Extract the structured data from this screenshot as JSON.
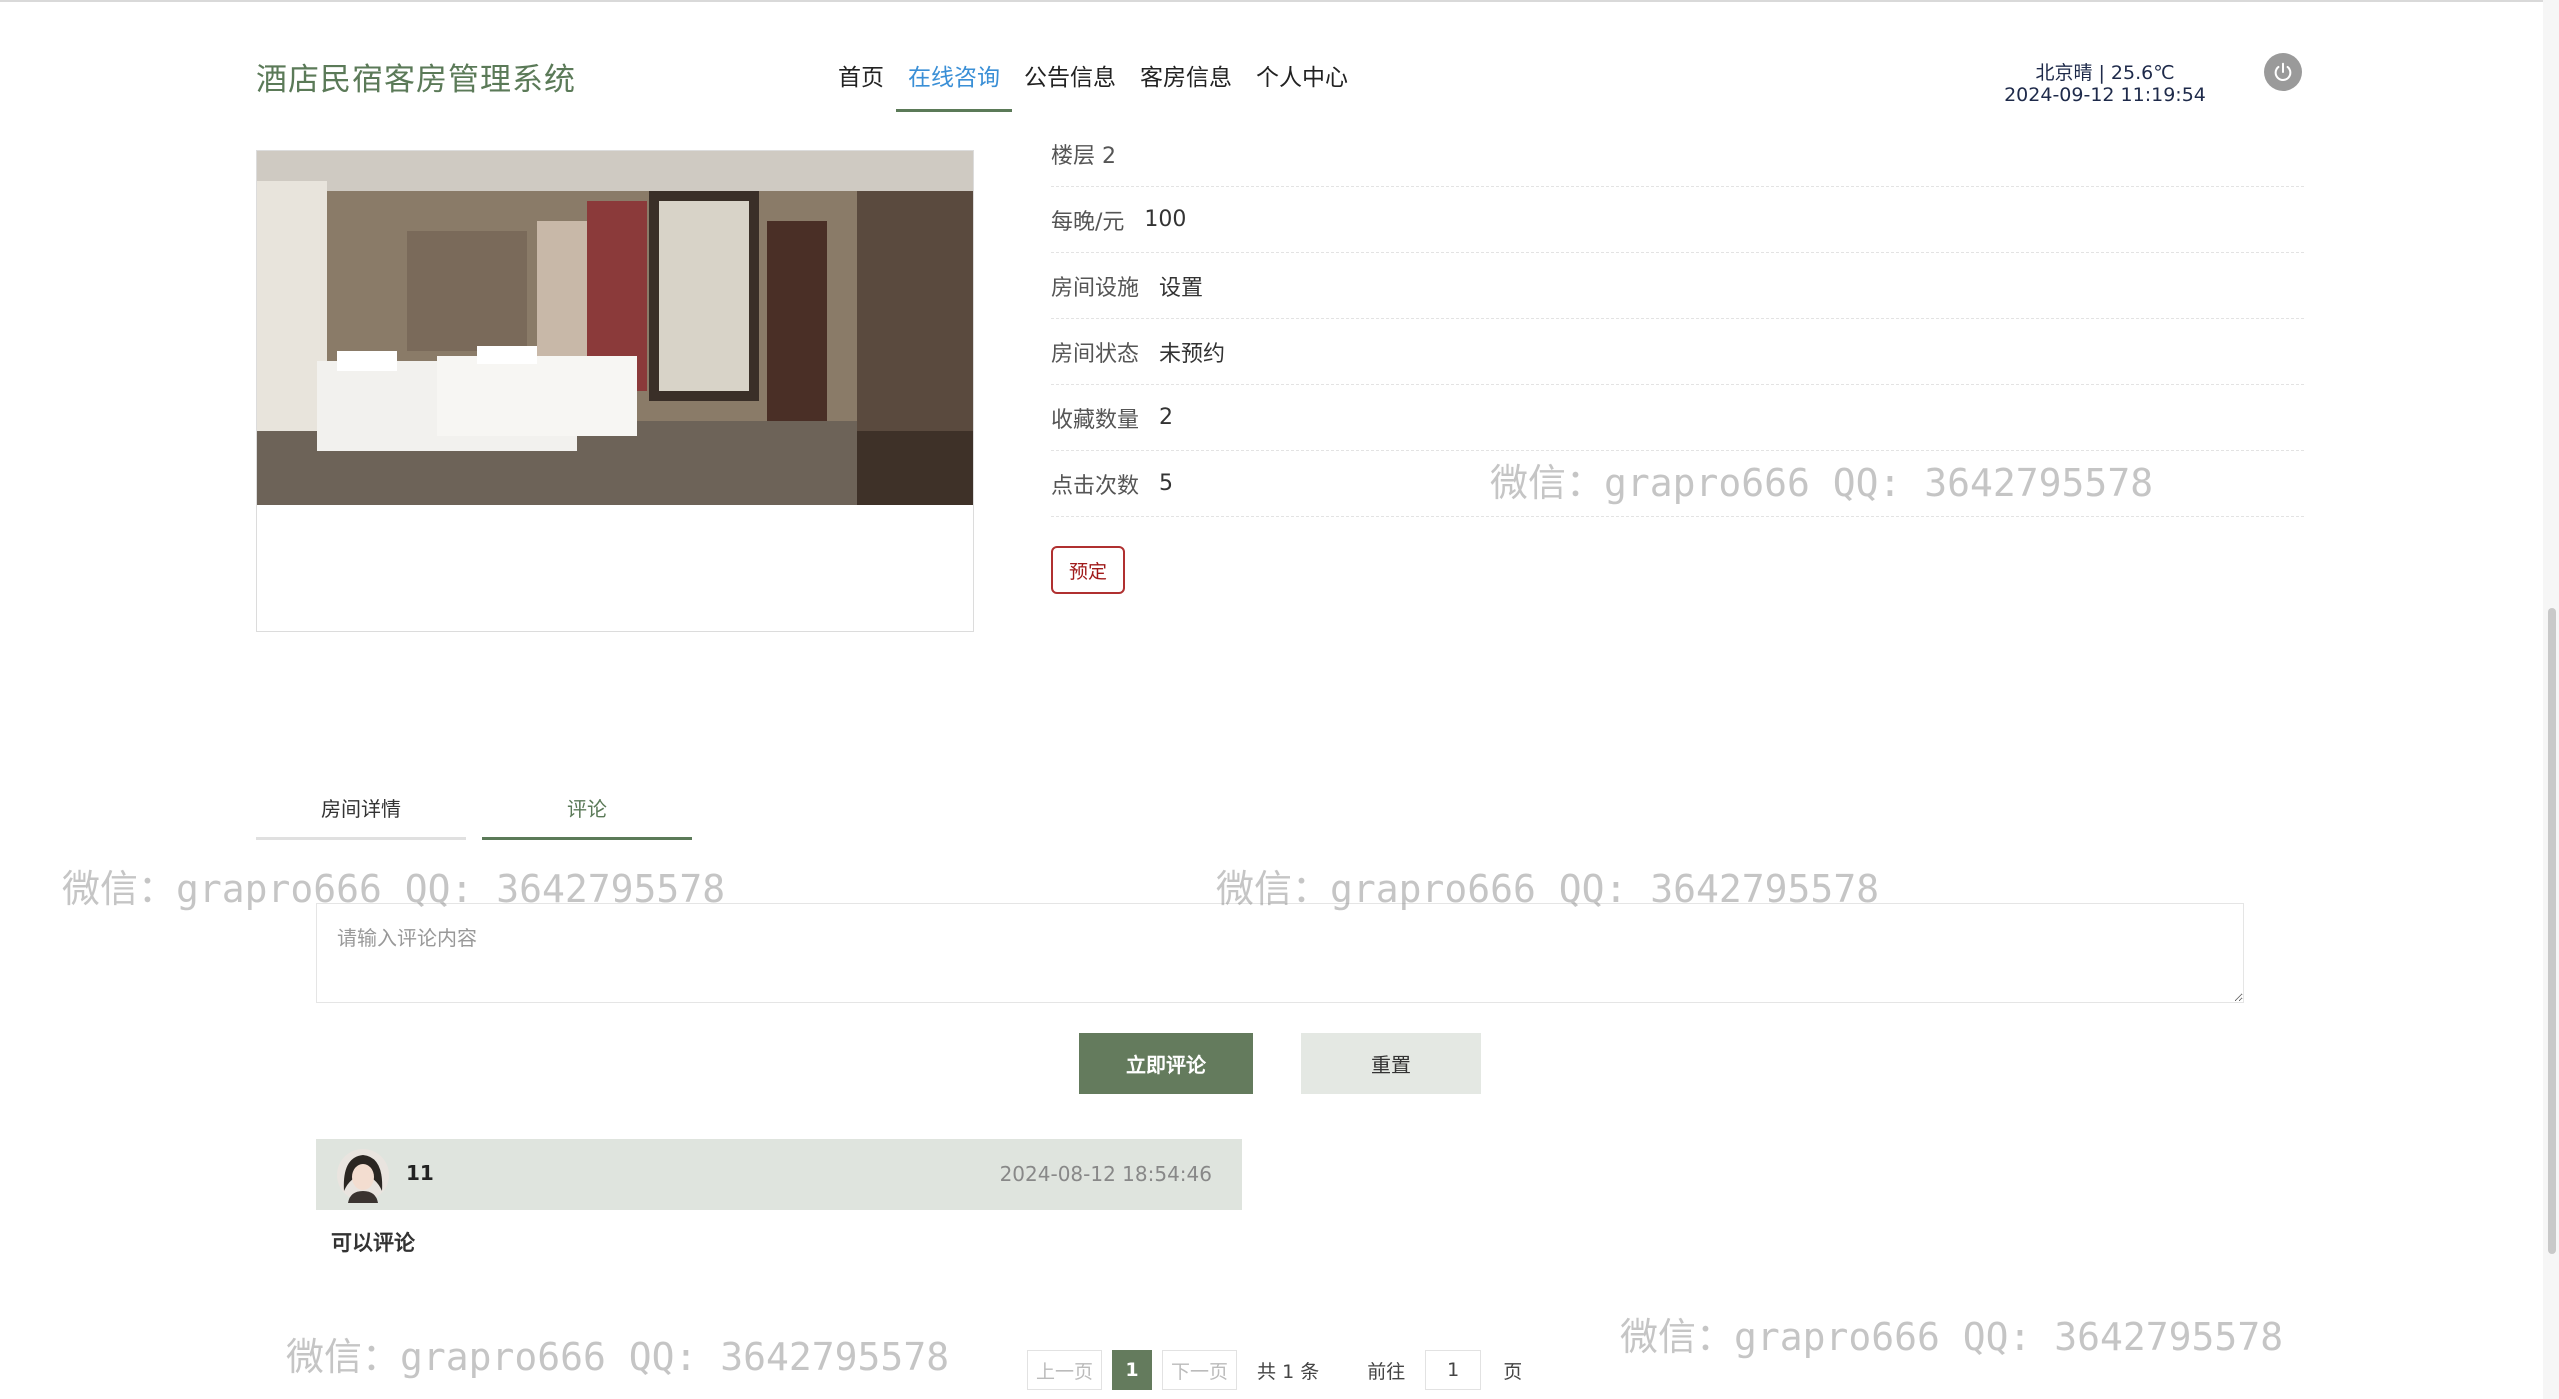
{
  "header": {
    "brand": "酒店民宿客房管理系统",
    "nav": [
      "首页",
      "在线咨询",
      "公告信息",
      "客房信息",
      "个人中心"
    ],
    "active_nav": 1,
    "weather_line1": "北京晴 | 25.6℃",
    "weather_line2": "2024-09-12   11:19:54"
  },
  "details": {
    "partial_row": "楼层  2",
    "rows": [
      {
        "label": "每晚/元",
        "value": "100"
      },
      {
        "label": "房间设施",
        "value": "设置"
      },
      {
        "label": "房间状态",
        "value": "未预约"
      },
      {
        "label": "收藏数量",
        "value": "2"
      },
      {
        "label": "点击次数",
        "value": "5"
      }
    ],
    "book_label": "预定"
  },
  "tabs": [
    "房间详情",
    "评论"
  ],
  "active_tab": 1,
  "comment_form": {
    "placeholder": "请输入评论内容",
    "submit_label": "立即评论",
    "reset_label": "重置"
  },
  "comments": [
    {
      "user": "11",
      "time": "2024-08-12 18:54:46",
      "text": "可以评论"
    }
  ],
  "pagination": {
    "prev": "上一页",
    "page": "1",
    "next": "下一页",
    "total": "共 1 条",
    "goto": "前往",
    "goto_value": "1",
    "page_suffix": "页"
  },
  "watermark": "微信：grapro666 QQ: 3642795578",
  "colors": {
    "brand": "#5b7a58",
    "active_nav": "#3a8fd6",
    "primary_button": "#647b5d",
    "book_border": "#b03030"
  }
}
